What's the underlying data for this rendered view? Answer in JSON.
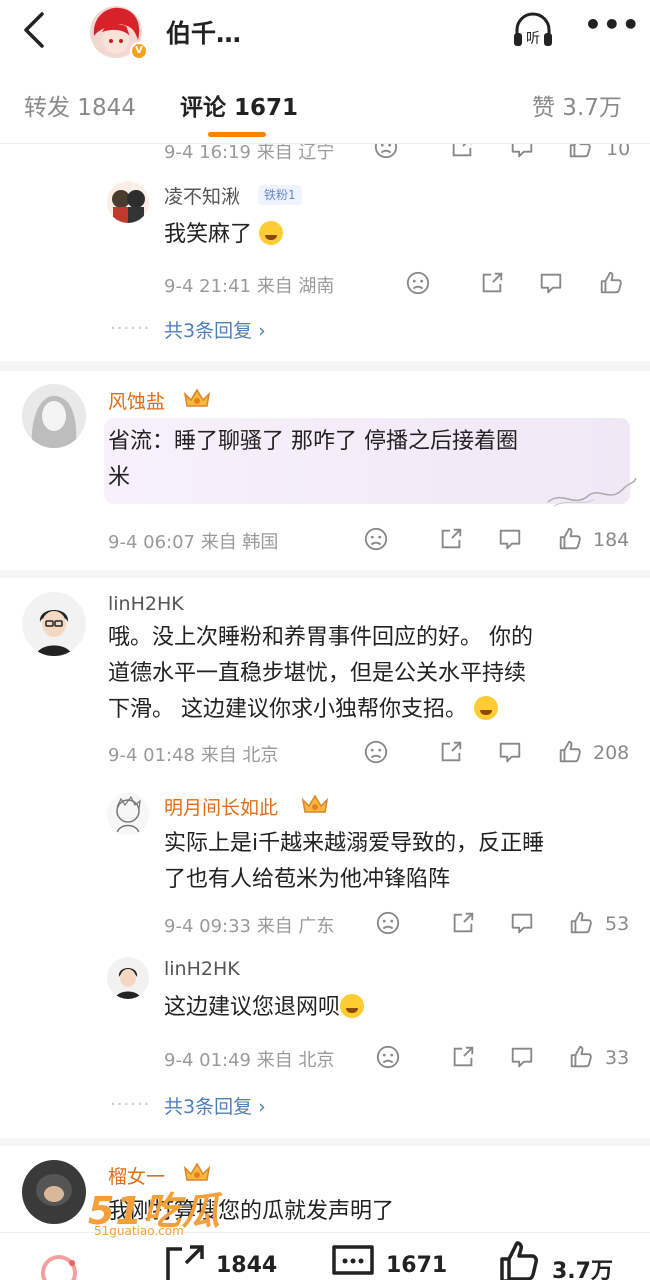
{
  "header": {
    "title": "伯千…"
  },
  "tabs": {
    "reposts": "转发 1844",
    "comments": "评论 1671",
    "likes": "赞 3.7万"
  },
  "partial_comment": {
    "meta": "9-4 16:19 来自 辽宁",
    "likes": "10"
  },
  "comments": [
    {
      "name": "凌不知湫",
      "fan_badge": "铁粉1",
      "text": "我笑麻了",
      "meta": "9-4 21:41 来自 湖南",
      "more": "共3条回复 ›"
    },
    {
      "name": "风蚀盐",
      "text_line1": "省流：睡了聊骚了 那咋了 停播之后接着圈",
      "text_line2": "米",
      "meta": "9-4 06:07 来自 韩国",
      "likes": "184"
    },
    {
      "name": "linH2HK",
      "text_line1": "哦。没上次睡粉和养胃事件回应的好。 你的",
      "text_line2": "道德水平一直稳步堪忧，但是公关水平持续",
      "text_line3": "下滑。 这边建议你求小独帮你支招。",
      "meta": "9-4 01:48 来自 北京",
      "likes": "208"
    },
    {
      "name": "明月间长如此",
      "text_line1": "实际上是i千越来越溺爱导致的，反正睡",
      "text_line2": "了也有人给苞米为他冲锋陷阵",
      "meta": "9-4 09:33 来自 广东",
      "likes": "53"
    },
    {
      "name": "linH2HK",
      "text": "这边建议您退网呗",
      "meta": "9-4 01:49 来自 北京",
      "likes": "33",
      "more": "共3条回复 ›"
    },
    {
      "name": "榴女一",
      "text": "我刚打算搜您的瓜就发声明了"
    }
  ],
  "dots": "······",
  "bottom": {
    "reposts": "1844",
    "comments": "1671",
    "likes": "3.7万"
  },
  "watermark": {
    "big": "51吃瓜",
    "small": "51guatiao.com"
  },
  "colors": {
    "accent": "#ff8200",
    "vip_name": "#e06d18",
    "link": "#4f7fb6"
  }
}
